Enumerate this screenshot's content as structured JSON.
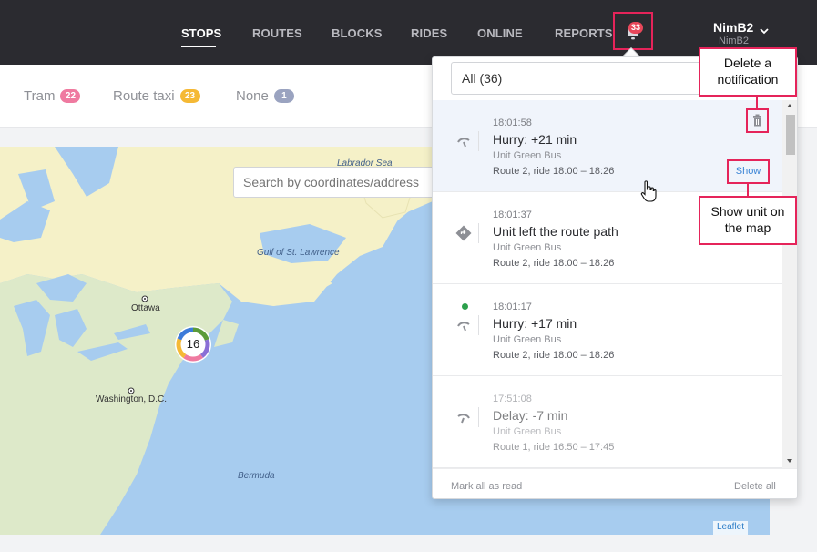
{
  "nav": {
    "items": [
      {
        "label": "STOPS",
        "active": true
      },
      {
        "label": "ROUTES",
        "active": false
      },
      {
        "label": "BLOCKS",
        "active": false
      },
      {
        "label": "RIDES",
        "active": false
      },
      {
        "label": "ONLINE",
        "active": false
      },
      {
        "label": "REPORTS",
        "active": false
      }
    ],
    "notification_count": "33",
    "user_name": "NimB2",
    "user_login": "NimB2"
  },
  "filters": [
    {
      "label": "Tram",
      "count": "22",
      "color": "#ef7aa0"
    },
    {
      "label": "Route taxi",
      "count": "23",
      "color": "#f5b935"
    },
    {
      "label": "None",
      "count": "1",
      "color": "#9aa3c0"
    }
  ],
  "map": {
    "search_placeholder": "Search by coordinates/address",
    "labels": {
      "labrador_sea": "Labrador Sea",
      "gulf": "Gulf of St. Lawrence",
      "ottawa": "Ottawa",
      "washington": "Washington, D.C.",
      "bermuda": "Bermuda"
    },
    "cluster_count": "16",
    "attribution": "Leaflet"
  },
  "panel": {
    "filter_value": "All (36)",
    "notifications": [
      {
        "time": "18:01:58",
        "title": "Hurry: +21 min",
        "unit": "Unit Green Bus",
        "route": "Route 2, ride 18:00 – 18:26",
        "icon": "hurry-icon",
        "new": false,
        "faded": false
      },
      {
        "time": "18:01:37",
        "title": "Unit left the route path",
        "unit": "Unit Green Bus",
        "route": "Route 2, ride 18:00 – 18:26",
        "icon": "route-deviation-icon",
        "new": false,
        "faded": false
      },
      {
        "time": "18:01:17",
        "title": "Hurry: +17 min",
        "unit": "Unit Green Bus",
        "route": "Route 2, ride 18:00 – 18:26",
        "icon": "hurry-icon",
        "new": true,
        "faded": false
      },
      {
        "time": "17:51:08",
        "title": "Delay: -7 min",
        "unit": "Unit Green Bus",
        "route": "Route 1, ride 16:50 – 17:45",
        "icon": "delay-icon",
        "new": false,
        "faded": true
      }
    ],
    "show_label": "Show",
    "mark_all_read": "Mark all as read",
    "delete_all": "Delete all"
  },
  "callouts": {
    "delete": "Delete a notification",
    "show": "Show unit on the map"
  },
  "colors": {
    "accent": "#e5245a",
    "topbar": "#2b2b30",
    "link": "#3a84d6"
  }
}
